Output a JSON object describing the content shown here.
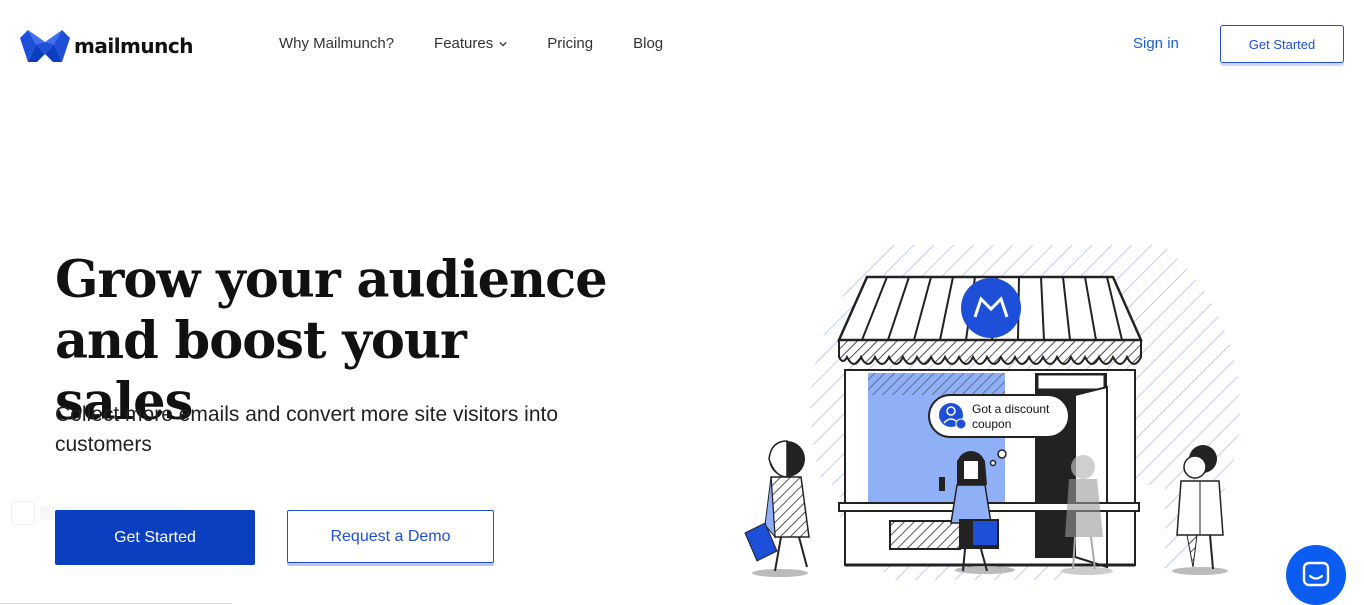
{
  "brand": {
    "name": "mailmunch",
    "color": "#1e4fd8"
  },
  "nav": {
    "items": [
      {
        "label": "Why Mailmunch?"
      },
      {
        "label": "Features",
        "icon": "chevron-down-icon"
      },
      {
        "label": "Pricing"
      },
      {
        "label": "Blog"
      }
    ],
    "signin": "Sign in",
    "cta": "Get Started"
  },
  "hero": {
    "title": "Grow your audience and boost your sales",
    "subtitle": "Collect more emails and convert more site visitors into customers",
    "primary_cta": "Get Started",
    "secondary_cta": "Request a Demo"
  },
  "illustration": {
    "bubble_text_1": "Got a discount",
    "bubble_text_2": "coupon"
  },
  "chat_widget": {
    "icon": "chat-icon",
    "color": "#0b5cf0"
  }
}
